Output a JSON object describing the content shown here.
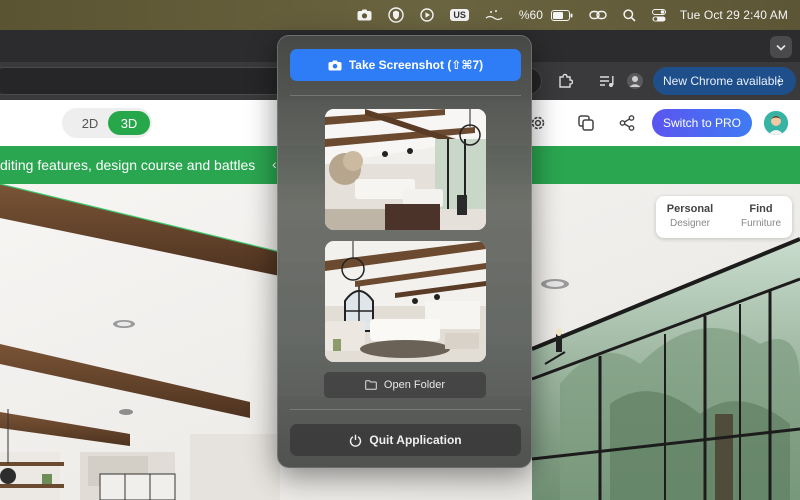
{
  "menubar": {
    "icons": [
      "camera-icon",
      "vpn-shield-icon",
      "play-circle-icon",
      "keyboard-layout-icon",
      "wifi-calm-icon",
      "battery-icon",
      "link-icon",
      "search-icon",
      "control-center-icon"
    ],
    "input_source": "US",
    "battery_percent": "%60",
    "clock": "Tue Oct 29  2:40 AM"
  },
  "browser": {
    "update_pill": "New Chrome available",
    "update_menu": "⋮"
  },
  "app": {
    "view_toggle": {
      "option_2d": "2D",
      "option_3d": "3D",
      "selected": "3D"
    },
    "switch_pro": "Switch to PRO",
    "promo_text": "diting features, design course and battles",
    "promo_arrow": "‹",
    "top_right_card": {
      "personal_title": "Personal",
      "personal_sub": "Designer",
      "find_title": "Find",
      "find_sub": "Furniture"
    }
  },
  "popup": {
    "take_screenshot": "Take Screenshot (⇧⌘7)",
    "open_folder": "Open Folder",
    "quit": "Quit Application",
    "thumbnails": [
      "screenshot-1",
      "screenshot-2"
    ]
  },
  "colors": {
    "accent_blue": "#2f7df6",
    "brand_green": "#2aa650",
    "pro_gradient_start": "#5b55f0",
    "pro_gradient_end": "#3f7bf3"
  }
}
